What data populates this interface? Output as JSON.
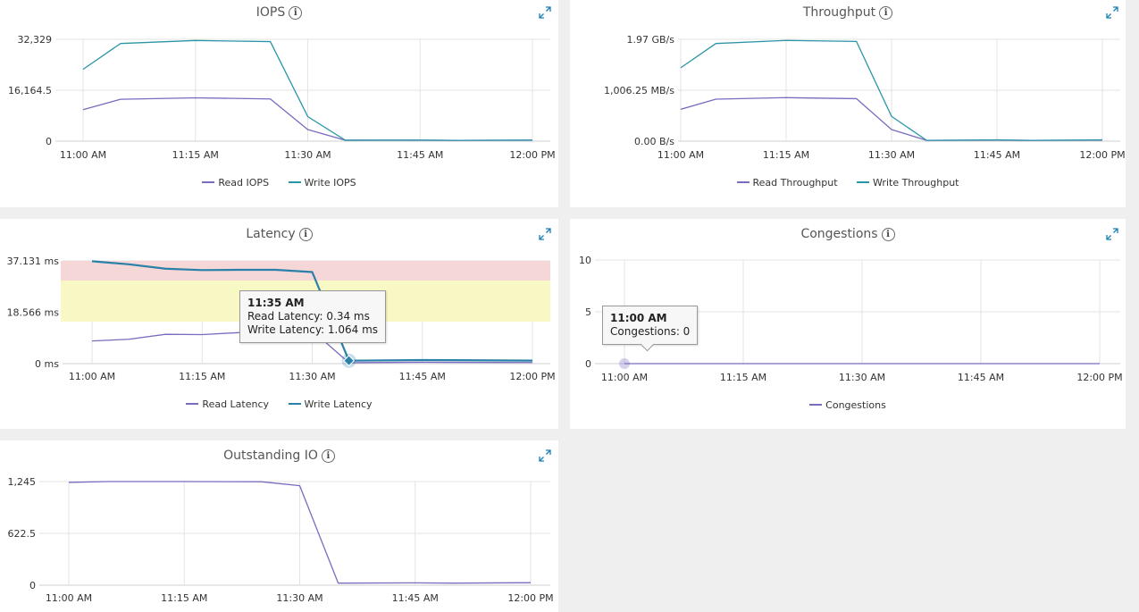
{
  "colors": {
    "read": "#7a6bbf",
    "write": "#2a95a8",
    "write_latency": "#2980a8",
    "grid": "#e3e3e3",
    "band_red": "#f5d7d7",
    "band_yellow": "#f8f8c4"
  },
  "x_ticks": [
    "11:00 AM",
    "11:15 AM",
    "11:30 AM",
    "11:45 AM",
    "12:00 PM"
  ],
  "panels": {
    "iops": {
      "title": "IOPS",
      "legend": [
        "Read IOPS",
        "Write IOPS"
      ]
    },
    "throughput": {
      "title": "Throughput",
      "legend": [
        "Read Throughput",
        "Write Throughput"
      ]
    },
    "latency": {
      "title": "Latency",
      "legend": [
        "Read Latency",
        "Write Latency"
      ],
      "tooltip": {
        "time": "11:35 AM",
        "read": "Read Latency: 0.34 ms",
        "write": "Write Latency: 1.064 ms"
      }
    },
    "congestions": {
      "title": "Congestions",
      "legend": [
        "Congestions"
      ],
      "tooltip": {
        "time": "11:00 AM",
        "value": "Congestions: 0"
      }
    },
    "outstanding": {
      "title": "Outstanding IO"
    }
  },
  "chart_data": [
    {
      "type": "line",
      "title": "IOPS",
      "x": [
        "11:00 AM",
        "11:05 AM",
        "11:15 AM",
        "11:25 AM",
        "11:30 AM",
        "11:35 AM",
        "11:45 AM",
        "11:50 AM",
        "12:00 PM"
      ],
      "y_ticks": [
        "0",
        "16,164.5",
        "32,329"
      ],
      "ylim": [
        0,
        32329
      ],
      "series": [
        {
          "name": "Read IOPS",
          "values": [
            10000,
            13300,
            13750,
            13400,
            3700,
            300,
            300,
            250,
            300
          ]
        },
        {
          "name": "Write IOPS",
          "values": [
            22800,
            31000,
            31950,
            31600,
            7800,
            300,
            350,
            250,
            350
          ]
        }
      ]
    },
    {
      "type": "line",
      "title": "Throughput",
      "x": [
        "11:00 AM",
        "11:05 AM",
        "11:15 AM",
        "11:25 AM",
        "11:30 AM",
        "11:35 AM",
        "11:45 AM",
        "11:50 AM",
        "12:00 PM"
      ],
      "y_ticks": [
        "0.00 B/s",
        "1,006.25 MB/s",
        "1.97 GB/s"
      ],
      "ylim": [
        0,
        2012.5
      ],
      "series": [
        {
          "name": "Read Throughput",
          "values": [
            630,
            830,
            860,
            840,
            230,
            15,
            20,
            15,
            20
          ]
        },
        {
          "name": "Write Throughput",
          "values": [
            1450,
            1930,
            1990,
            1970,
            490,
            15,
            25,
            15,
            25
          ]
        }
      ]
    },
    {
      "type": "line",
      "title": "Latency",
      "x": [
        "11:00 AM",
        "11:05 AM",
        "11:10 AM",
        "11:15 AM",
        "11:20 AM",
        "11:25 AM",
        "11:30 AM",
        "11:35 AM",
        "11:45 AM",
        "12:00 PM"
      ],
      "y_ticks": [
        "0 ms",
        "18.566 ms",
        "37.131 ms"
      ],
      "ylim": [
        0,
        37.131
      ],
      "series": [
        {
          "name": "Read Latency",
          "values": [
            8.2,
            8.8,
            10.6,
            10.5,
            11.2,
            11.8,
            11.9,
            0.34,
            0.5,
            0.4
          ]
        },
        {
          "name": "Write Latency",
          "values": [
            37.0,
            35.9,
            34.3,
            33.8,
            33.9,
            33.9,
            33.1,
            1.064,
            1.3,
            1.1
          ]
        }
      ]
    },
    {
      "type": "line",
      "title": "Congestions",
      "x": [
        "11:00 AM",
        "11:15 AM",
        "11:30 AM",
        "11:45 AM",
        "12:00 PM"
      ],
      "y_ticks": [
        "0",
        "5",
        "10"
      ],
      "ylim": [
        0,
        10
      ],
      "series": [
        {
          "name": "Congestions",
          "values": [
            0,
            0,
            0,
            0,
            0
          ]
        }
      ]
    },
    {
      "type": "line",
      "title": "Outstanding IO",
      "x": [
        "11:00 AM",
        "11:05 AM",
        "11:15 AM",
        "11:25 AM",
        "11:30 AM",
        "11:35 AM",
        "11:45 AM",
        "11:50 AM",
        "12:00 PM"
      ],
      "y_ticks": [
        "0",
        "622.5",
        "1,245"
      ],
      "ylim": [
        0,
        1245
      ],
      "series": [
        {
          "name": "Outstanding IO",
          "values": [
            1235,
            1245,
            1245,
            1243,
            1195,
            25,
            28,
            25,
            30
          ]
        }
      ]
    }
  ]
}
